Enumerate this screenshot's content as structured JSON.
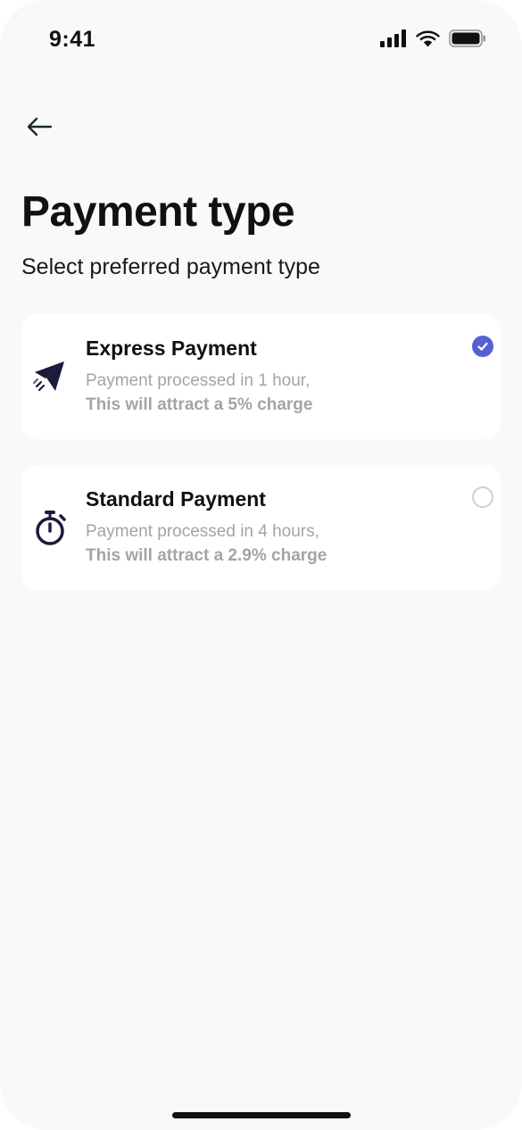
{
  "status_bar": {
    "time": "9:41",
    "icons": [
      "signal-icon",
      "wifi-icon",
      "battery-icon"
    ]
  },
  "header": {
    "back_icon": "arrow-left-icon",
    "title": "Payment type",
    "subtitle": "Select preferred payment type"
  },
  "options": [
    {
      "icon": "paper-plane-icon",
      "title": "Express Payment",
      "description": "Payment processed in 1 hour,",
      "charge": "This will attract a 5% charge",
      "selected": true
    },
    {
      "icon": "stopwatch-icon",
      "title": "Standard Payment",
      "description": "Payment processed in 4 hours,",
      "charge": "This will attract a 2.9% charge",
      "selected": false
    }
  ],
  "colors": {
    "accent": "#5560d4",
    "background": "#f9f9f9",
    "card": "#ffffff",
    "muted_text": "#a3a3aa",
    "icon_dark": "#1c1b3a"
  }
}
